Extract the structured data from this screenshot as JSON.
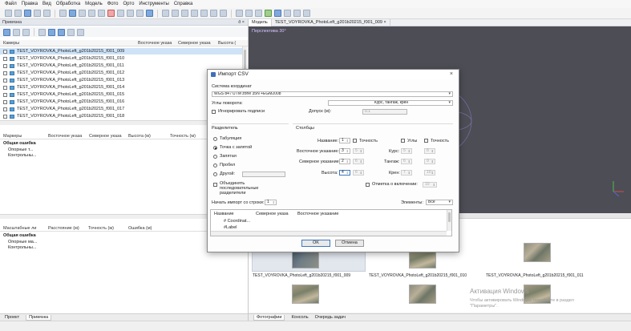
{
  "menu": [
    "Файл",
    "Правка",
    "Вид",
    "Обработка",
    "Модель",
    "Фото",
    "Орто",
    "Инструменты",
    "Справка"
  ],
  "workspace": {
    "title": "Привязка",
    "pin": "ð ×",
    "cameras_label": "Камеры",
    "col_north": "Северное указа",
    "col_east": "Восточное указа",
    "col_height": "Высота (",
    "cameras": [
      "TEST_VOYROVKA_PhotoLeft_g201b20215_f001_009",
      "TEST_VOYROVKA_PhotoLeft_g201b20215_f001_010",
      "TEST_VOYROVKA_PhotoLeft_g201b20215_f001_011",
      "TEST_VOYROVKA_PhotoLeft_g201b20215_f001_012",
      "TEST_VOYROVKA_PhotoLeft_g201b20215_f001_013",
      "TEST_VOYROVKA_PhotoLeft_g201b20215_f001_014",
      "TEST_VOYROVKA_PhotoLeft_g201b20215_f001_015",
      "TEST_VOYROVKA_PhotoLeft_g201b20215_f001_016",
      "TEST_VOYROVKA_PhotoLeft_g201b20215_f001_017",
      "TEST_VOYROVKA_PhotoLeft_g201b20215_f001_018"
    ],
    "markers_header": {
      "c1": "Маркеры",
      "c2": "Восточное указа",
      "c3": "Северное указа",
      "c4": "Высота (м)",
      "c5": "Точность (м)"
    },
    "markers_tree": {
      "total": "Общая ошибка",
      "control": "Опорные т...",
      "check": "Контрольны..."
    },
    "scale_header": {
      "c1": "Масштабные ли",
      "c2": "Расстояние (м)",
      "c3": "Точность (м)",
      "c4": "Ошибка (м)"
    },
    "scale_tree": {
      "total": "Общая ошибка",
      "control": "Опорные ма...",
      "check": "Контрольны..."
    },
    "bottom_tabs": [
      "Проект",
      "Привязка"
    ]
  },
  "model": {
    "tabs": [
      "Модель",
      "TEST_VOYROVKA_PhotoLeft_g201b20215_f001_009"
    ],
    "close": "×",
    "perspective": "Перспектива 30°"
  },
  "photos": {
    "captions": [
      "TEST_VOYROVKA_PhotoLeft_g201b20215_f001_009",
      "TEST_VOYROVKA_PhotoLeft_g201b20215_f001_010",
      "TEST_VOYROVKA_PhotoLeft_g201b20215_f001_011"
    ],
    "watermark_title": "Активация Windows",
    "watermark_text1": "Чтобы активировать Windows, перейдите в раздел",
    "watermark_text2": "\"Параметры\".",
    "tabs": [
      "Фотографии",
      "Консоль",
      "Очередь задач"
    ]
  },
  "dialog": {
    "title": "Импорт CSV",
    "close": "×",
    "crs_label": "Система координат",
    "crs_value": "WGS 84 / UTM zone 35N +EGM2008",
    "angles_label": "Углы поворота:",
    "angles_value": "Курс, тангаж, крен",
    "ignore_labels": "Игнорировать подписи",
    "tolerance_label": "Допуск (м):",
    "tolerance_value": "0.1",
    "delimiter_label": "Разделитель",
    "delimiters": [
      "Табуляция",
      "Точка с запятой",
      "Запятая",
      "Пробел",
      "Другой:"
    ],
    "combine": "Объединять последовательные разделители",
    "columns_label": "Столбцы",
    "name_label": "Название:",
    "name_value": "1",
    "accuracy_label": "Точность",
    "angles_chk": "Углы",
    "accuracy2": "Точность",
    "east_label": "Восточное указание:",
    "east_value": "3",
    "north_label": "Северное указание:",
    "north_value": "2",
    "height_label": "Высота:",
    "height_value": "4",
    "n5": "5",
    "n6": "6",
    "n7": "7",
    "n8": "8",
    "n9": "9",
    "n10": "10",
    "yaw_label": "Курс:",
    "pitch_label": "Тангаж:",
    "roll_label": "Крен:",
    "enabled_label": "Отметка о включении:",
    "start_label": "Начать импорт со строки:",
    "start_value": "1",
    "items_label": "Элементы:",
    "items_value": "Все",
    "table_cols": [
      "Название",
      "Северное указа",
      "Восточное указание"
    ],
    "table_row1": "# Coordinat...",
    "table_row2": "#Label",
    "ok": "OK",
    "cancel": "Отмена"
  },
  "colors": {
    "viewport": "#4d4d56",
    "accent": "#3f72b5",
    "selection": "#cfe3f7"
  }
}
